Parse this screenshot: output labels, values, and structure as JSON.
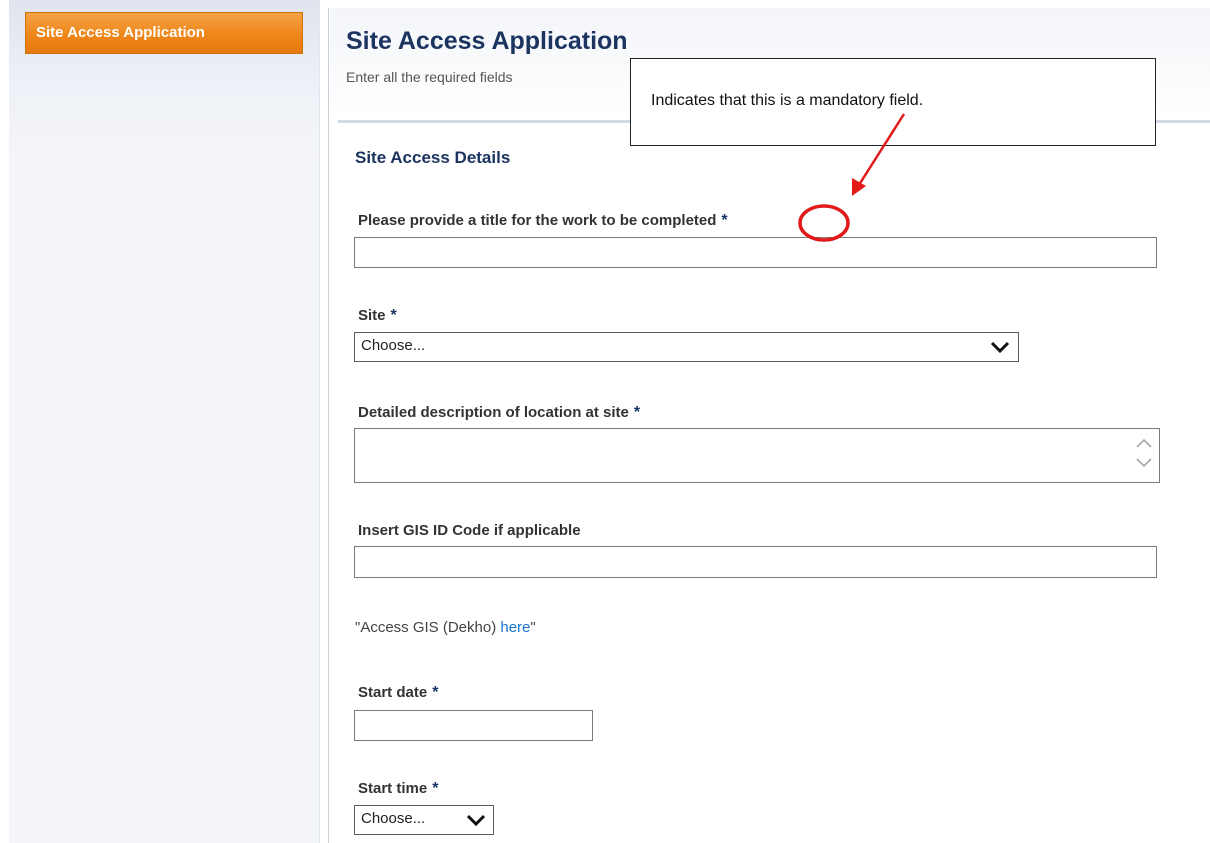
{
  "sidebar": {
    "active_item": "Site Access Application"
  },
  "header": {
    "title": "Site Access Application",
    "subtitle": "Enter all the required fields"
  },
  "annotation": {
    "text": "Indicates that this is a mandatory field.",
    "highlight_color": "#e21a1a"
  },
  "form": {
    "section_title": "Site Access Details",
    "required_marker": "*",
    "fields": {
      "work_title": {
        "label": "Please provide a title for the work to be completed",
        "value": ""
      },
      "site": {
        "label": "Site",
        "selected": "Choose..."
      },
      "location_description": {
        "label": "Detailed description of location at site",
        "value": ""
      },
      "gis_id": {
        "label": "Insert GIS ID Code if applicable",
        "value": ""
      },
      "gis_note_prefix": "\"Access GIS (Dekho) ",
      "gis_link_text": "here",
      "gis_note_suffix": "\"",
      "start_date": {
        "label": "Start date",
        "value": ""
      },
      "start_time": {
        "label": "Start time",
        "selected": "Choose..."
      }
    }
  },
  "colors": {
    "accent_orange": "#ef8619",
    "heading_navy": "#1c3560",
    "link_blue": "#1a74d2"
  }
}
